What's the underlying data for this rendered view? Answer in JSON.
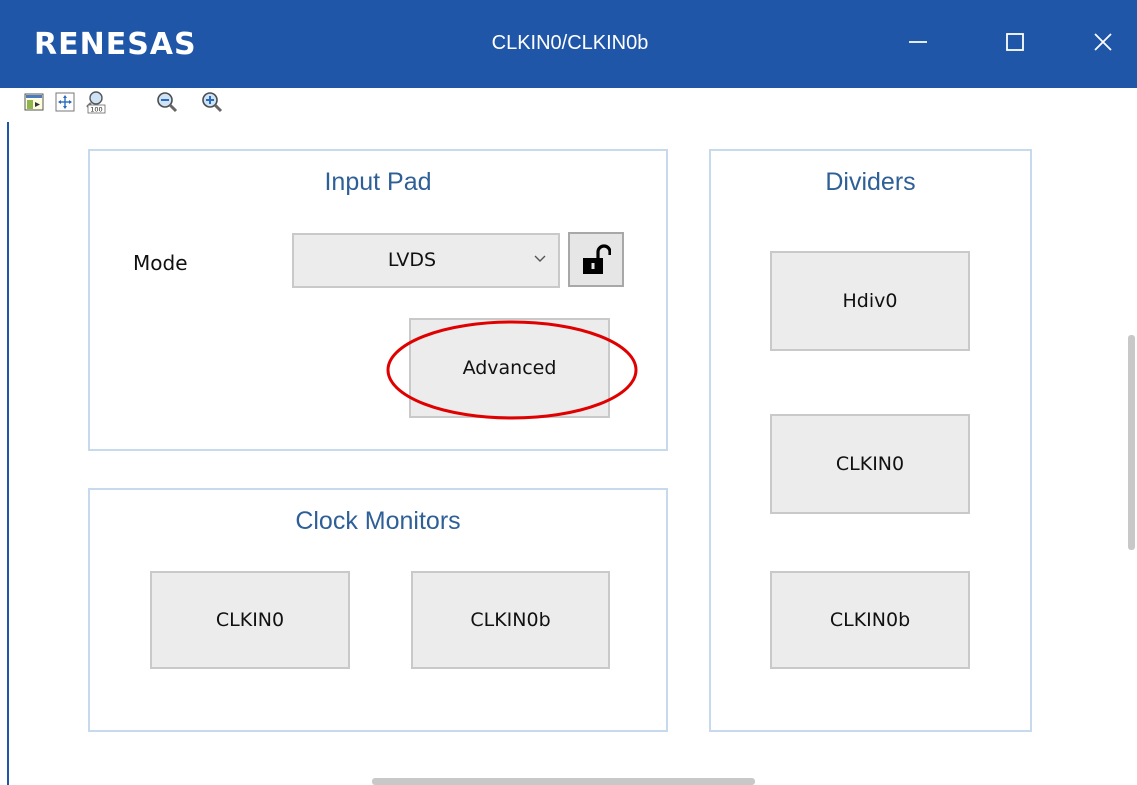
{
  "window": {
    "logo_text": "RENESAS",
    "title": "CLKIN0/CLKIN0b",
    "accent_color": "#1f56a8",
    "controls": [
      "minimize-icon",
      "maximize-icon",
      "close-icon"
    ]
  },
  "toolbar": {
    "icons": [
      "export-icon",
      "fit-to-window-icon",
      "zoom-100-icon",
      "zoom-out-icon",
      "zoom-in-icon"
    ]
  },
  "input_pad": {
    "title": "Input Pad",
    "mode_label": "Mode",
    "mode_value": "LVDS",
    "lock_icon": "unlocked-padlock-icon",
    "advanced_label": "Advanced",
    "highlight_color": "#e00000"
  },
  "clock_monitors": {
    "title": "Clock Monitors",
    "buttons": [
      "CLKIN0",
      "CLKIN0b"
    ]
  },
  "dividers": {
    "title": "Dividers",
    "buttons": [
      "Hdiv0",
      "CLKIN0",
      "CLKIN0b"
    ]
  }
}
